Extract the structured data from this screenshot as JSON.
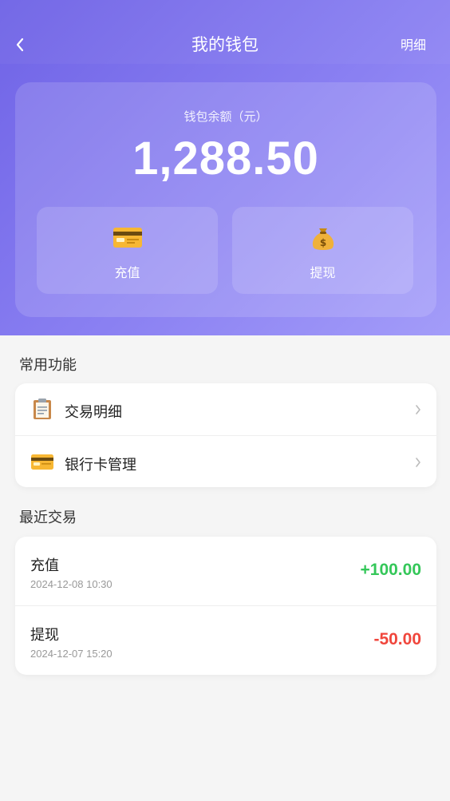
{
  "nav": {
    "title": "我的钱包",
    "detail_label": "明细"
  },
  "wallet": {
    "balance_label": "钱包余额（元）",
    "balance": "1,288.50",
    "actions": [
      {
        "label": "充值",
        "icon": "credit-card-icon"
      },
      {
        "label": "提现",
        "icon": "money-bag-icon"
      }
    ]
  },
  "common": {
    "title": "常用功能",
    "items": [
      {
        "label": "交易明细",
        "icon": "clipboard-icon"
      },
      {
        "label": "银行卡管理",
        "icon": "credit-card-icon"
      }
    ]
  },
  "recent": {
    "title": "最近交易",
    "transactions": [
      {
        "title": "充值",
        "time": "2024-12-08 10:30",
        "amount": "+100.00",
        "color": "#34c759"
      },
      {
        "title": "提现",
        "time": "2024-12-07 15:20",
        "amount": "-50.00",
        "color": "#f0463c"
      }
    ]
  },
  "colors": {
    "accent": "#7b70ec",
    "positive": "#34c759",
    "negative": "#f0463c"
  }
}
